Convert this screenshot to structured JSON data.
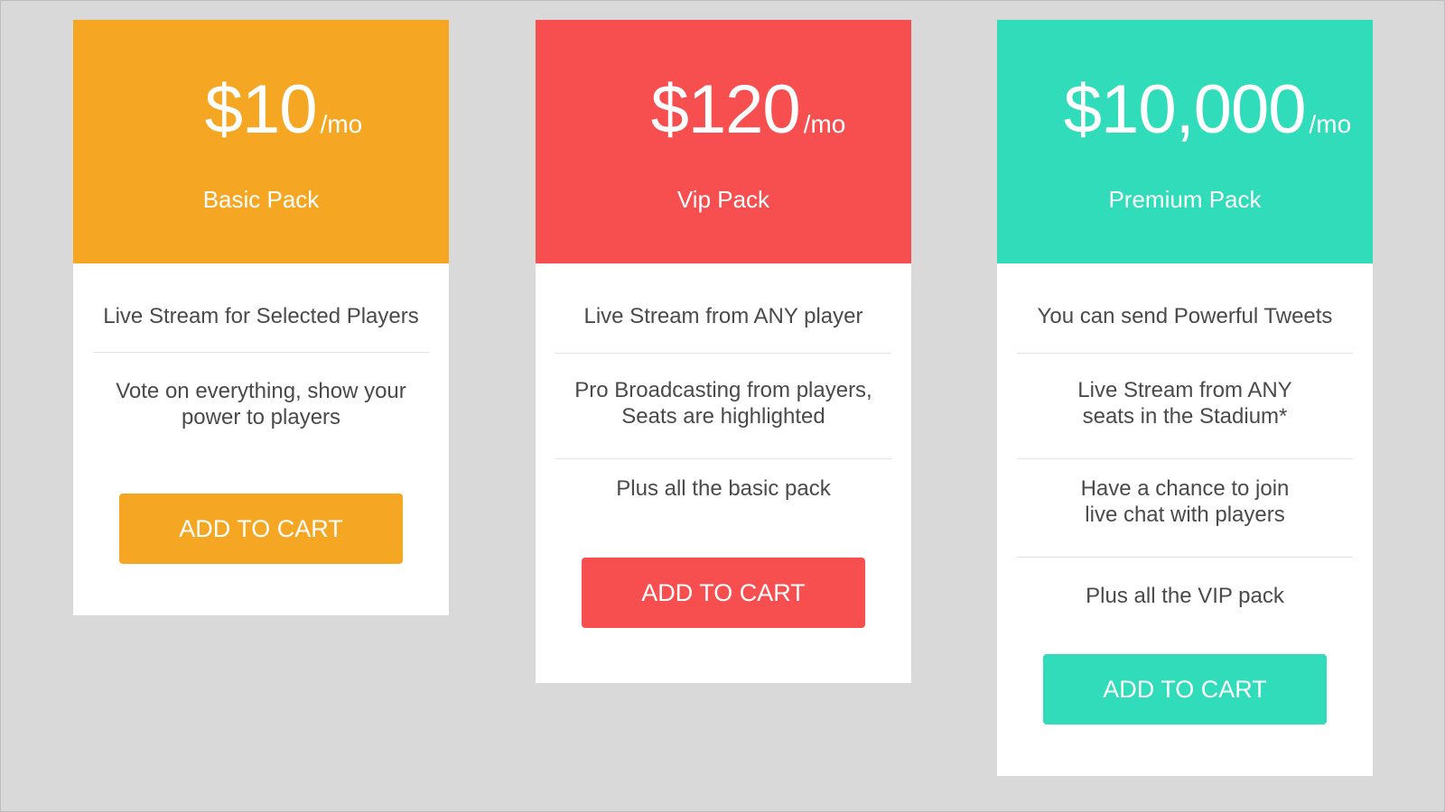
{
  "plans": [
    {
      "price": "$10",
      "period": "/mo",
      "name": "Basic Pack",
      "color": "#f5a623",
      "features": [
        "Live Stream for Selected Players",
        "Vote on everything, show your power to players"
      ],
      "button": "ADD TO CART"
    },
    {
      "price": "$120",
      "period": "/mo",
      "name": "Vip Pack",
      "color": "#f74f4f",
      "features": [
        "Live Stream from ANY player",
        "Pro Broadcasting from players, Seats are highlighted",
        "Plus all the basic pack"
      ],
      "button": "ADD TO CART"
    },
    {
      "price": "$10,000",
      "period": "/mo",
      "name": "Premium Pack",
      "color": "#30dcb9",
      "features": [
        "You can send Powerful Tweets",
        "Live Stream from ANY seats in the Stadium*",
        "Have a chance to join live chat with players",
        "Plus all the VIP pack"
      ],
      "button": "ADD TO CART"
    }
  ]
}
